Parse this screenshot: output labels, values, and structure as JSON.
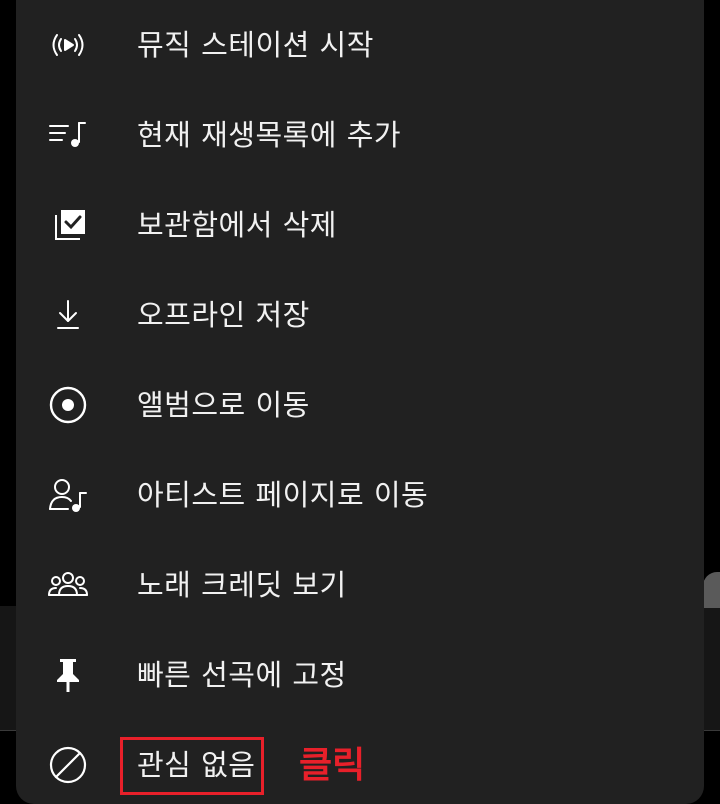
{
  "menu": {
    "items": [
      {
        "label": "뮤직 스테이션 시작",
        "icon": "radio-broadcast-icon"
      },
      {
        "label": "현재 재생목록에 추가",
        "icon": "queue-music-icon"
      },
      {
        "label": "보관함에서 삭제",
        "icon": "library-check-icon"
      },
      {
        "label": "오프라인 저장",
        "icon": "download-icon"
      },
      {
        "label": "앨범으로 이동",
        "icon": "album-disc-icon"
      },
      {
        "label": "아티스트 페이지로 이동",
        "icon": "artist-music-icon"
      },
      {
        "label": "노래 크레딧 보기",
        "icon": "people-group-icon"
      },
      {
        "label": "빠른 선곡에 고정",
        "icon": "pin-icon"
      },
      {
        "label": "관심 없음",
        "icon": "block-icon"
      }
    ]
  },
  "annotation": {
    "text": "클릭",
    "color": "#e8202a"
  },
  "colors": {
    "sheet": "#212121",
    "text": "#f1f1f1",
    "icon": "#ffffff"
  }
}
